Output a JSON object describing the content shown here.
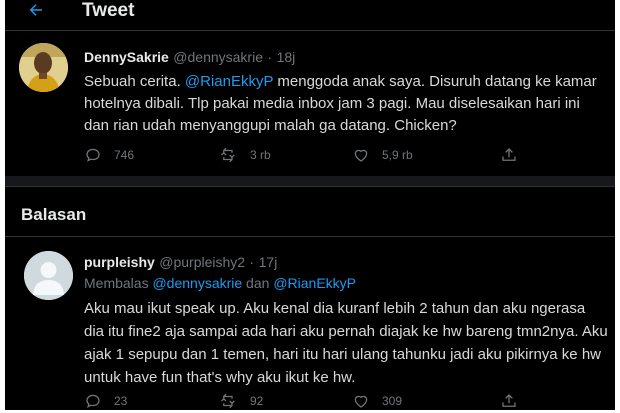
{
  "header": {
    "title": "Tweet",
    "back_icon": "arrow-left-icon"
  },
  "tweet": {
    "display_name": "DennySakrie",
    "handle": "@dennysakrie",
    "separator": "·",
    "time": "18j",
    "text_1": "Sebuah cerita. ",
    "mention": "@RianEkkyP",
    "text_2": " menggoda anak saya. Disuruh datang ke kamar hotelnya dibali. Tlp pakai media inbox jam 3 pagi. Mau diselesaikan hari ini dan rian udah menyanggupi malah ga datang. Chicken?",
    "replies": "746",
    "retweets": "3 rb",
    "likes": "5,9 rb",
    "icons": [
      "reply-icon",
      "retweet-icon",
      "like-icon",
      "share-icon"
    ]
  },
  "replies_section": {
    "title": "Balasan"
  },
  "reply": {
    "display_name": "purpleishy",
    "handle": "@purpleishy2",
    "separator": "·",
    "time": "17j",
    "replying_prefix": "Membalas ",
    "replying_user1": "@dennysakrie",
    "replying_and": " dan ",
    "replying_user2": "@RianEkkyP",
    "text": "Aku mau ikut speak up. Aku kenal dia kuranf lebih 2 tahun dan aku ngerasa dia itu fine2 aja sampai ada hari aku pernah diajak ke hw bareng tmn2nya. Aku ajak 1 sepupu dan 1 temen, hari itu hari ulang tahunku jadi aku pikirnya ke hw untuk have fun that's why aku ikut ke hw.",
    "replies": "23",
    "retweets": "92",
    "likes": "309"
  },
  "colors": {
    "background": "#000000",
    "accent": "#1d9bf0",
    "muted": "#71767b",
    "text": "#d9d9d9"
  }
}
